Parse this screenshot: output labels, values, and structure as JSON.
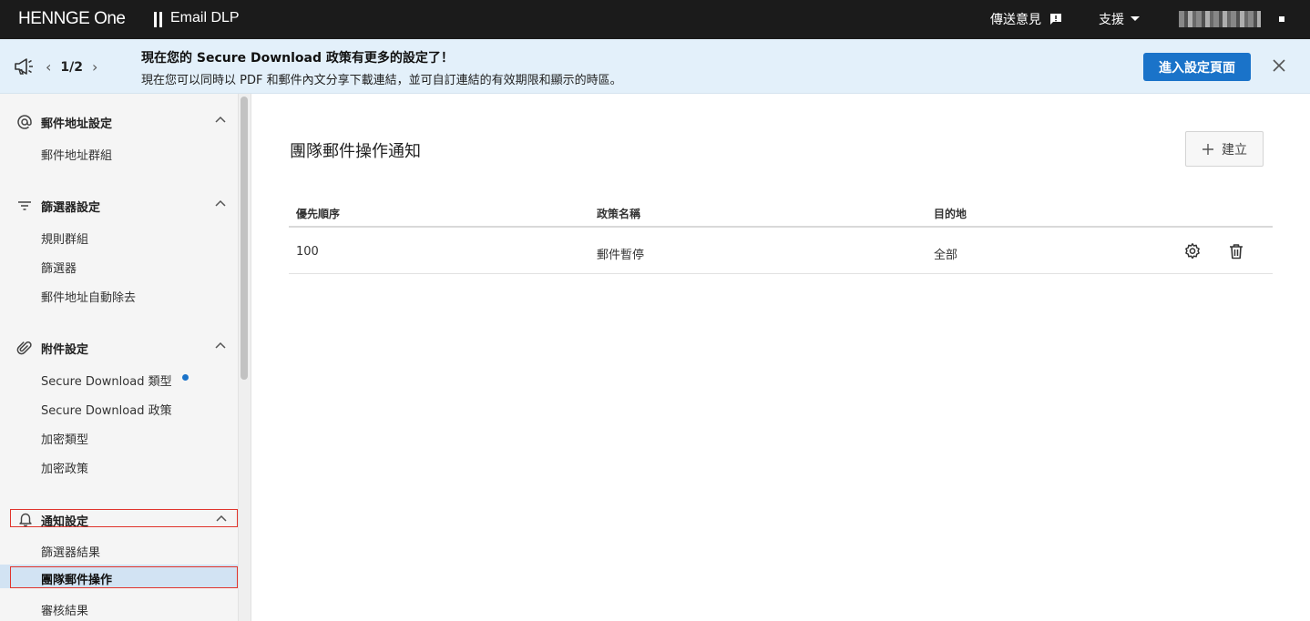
{
  "header": {
    "logo": "HENNGE One",
    "product": "Email DLP",
    "feedback_label": "傳送意見",
    "support_label": "支援"
  },
  "banner": {
    "pager": "1/2",
    "title": "現在您的 Secure Download 政策有更多的設定了！",
    "description": "現在您可以同時以 PDF 和郵件內文分享下載連結，並可自訂連結的有效期限和顯示的時區。",
    "button_label": "進入設定頁面"
  },
  "sidebar": {
    "sections": [
      {
        "label": "郵件地址設定",
        "icon": "at-icon",
        "items": [
          "郵件地址群組"
        ]
      },
      {
        "label": "篩選器設定",
        "icon": "filter-icon",
        "items": [
          "規則群組",
          "篩選器",
          "郵件地址自動除去"
        ]
      },
      {
        "label": "附件設定",
        "icon": "paperclip-icon",
        "items": [
          "Secure Download 類型",
          "Secure Download 政策",
          "加密類型",
          "加密政策"
        ]
      },
      {
        "label": "通知設定",
        "icon": "bell-icon",
        "items": [
          "篩選器結果",
          "團隊郵件操作",
          "審核結果"
        ]
      }
    ]
  },
  "main": {
    "title": "團隊郵件操作通知",
    "create_label": "建立",
    "columns": [
      "優先順序",
      "政策名稱",
      "目的地"
    ],
    "rows": [
      {
        "priority": "100",
        "name": "郵件暫停",
        "destination": "全部"
      }
    ]
  },
  "colors": {
    "accent": "#1a73c9",
    "topbar": "#1b1b1b",
    "banner": "#e3f0fa",
    "highlight_border": "#e0342c"
  }
}
